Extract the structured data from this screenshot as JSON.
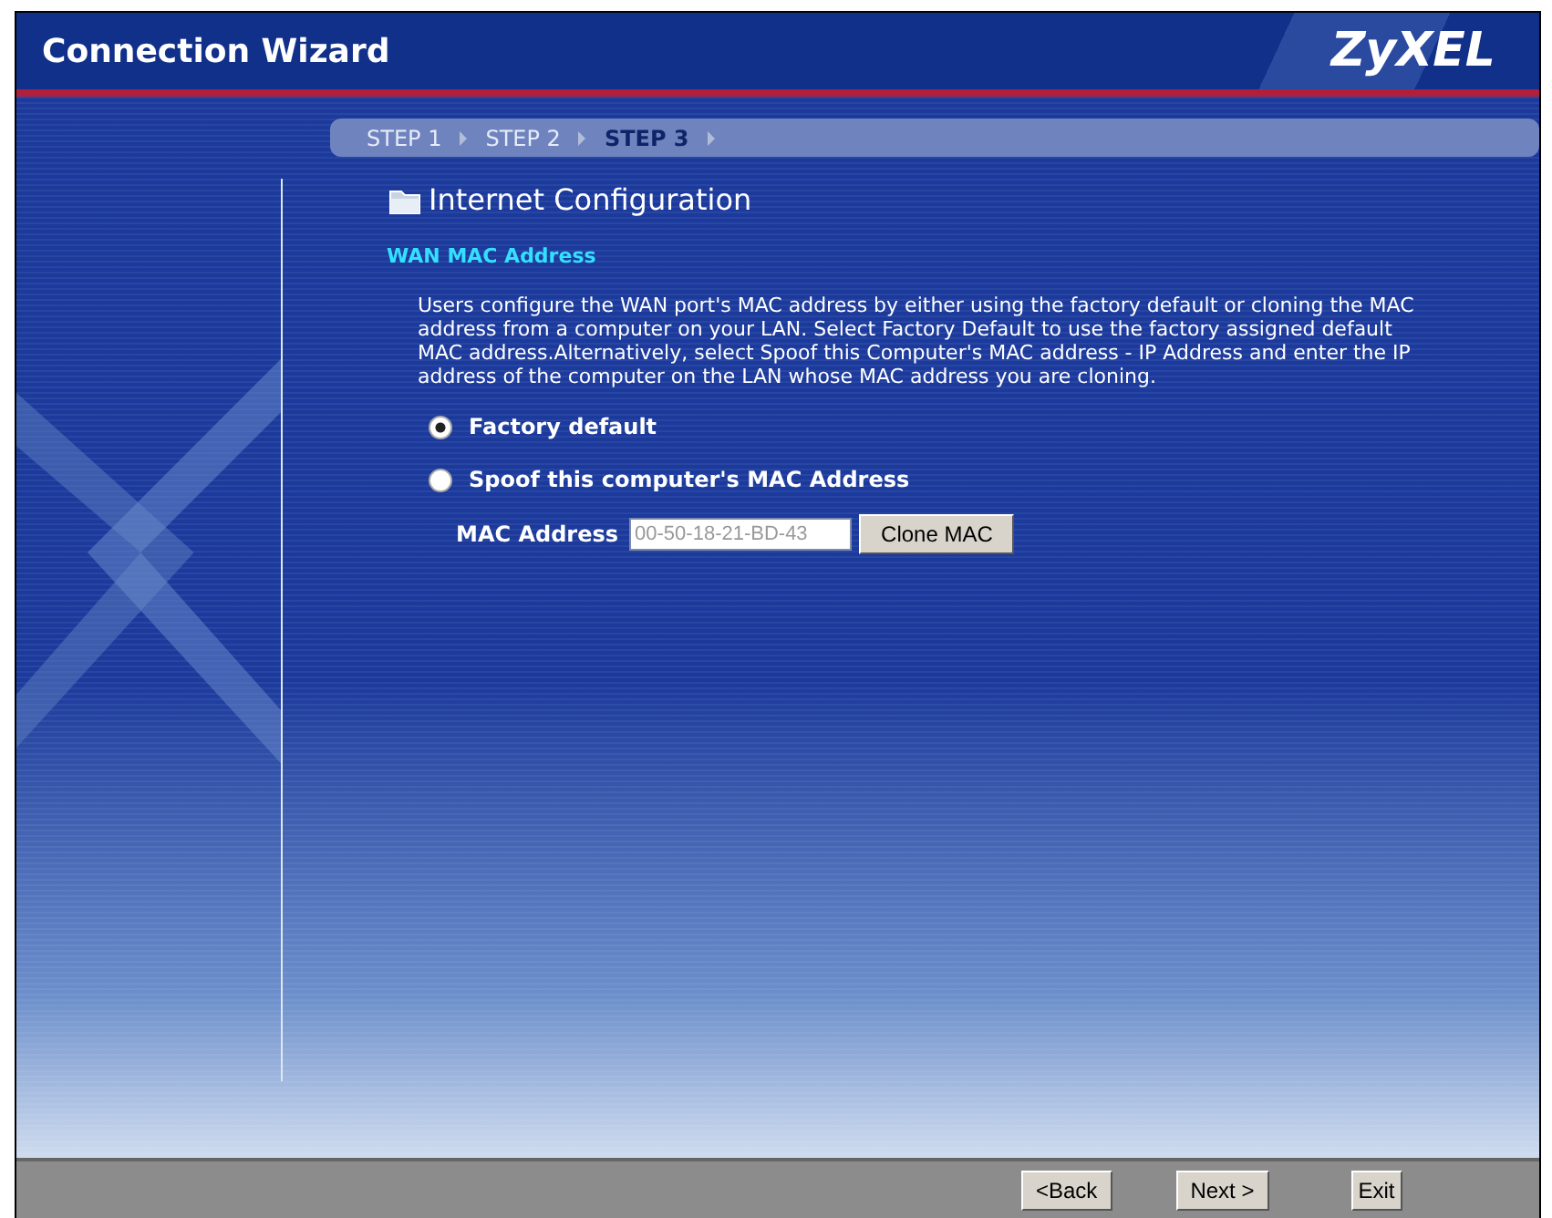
{
  "window": {
    "title": "Connection Wizard",
    "brand": "ZyXEL"
  },
  "steps": [
    {
      "label": "STEP 1",
      "selected": false
    },
    {
      "label": "STEP 2",
      "selected": false
    },
    {
      "label": "STEP 3",
      "selected": true
    }
  ],
  "section_title": "Internet Configuration",
  "subsection_title": "WAN MAC Address",
  "description": "Users configure the WAN port's MAC address by either using the factory default or cloning the MAC address from a computer on your LAN. Select Factory Default to use the factory assigned default MAC address.Alternatively, select Spoof this Computer's MAC address - IP Address and enter the IP address of the computer on the LAN whose MAC address you are cloning.",
  "options": [
    {
      "label": "Factory default",
      "selected": true
    },
    {
      "label": "Spoof this computer's MAC Address",
      "selected": false
    }
  ],
  "mac_field": {
    "label": "MAC Address",
    "value": "00-50-18-21-BD-43",
    "disabled": true,
    "button": "Clone MAC"
  },
  "buttons": [
    "<Back",
    "Next >",
    "Exit"
  ]
}
